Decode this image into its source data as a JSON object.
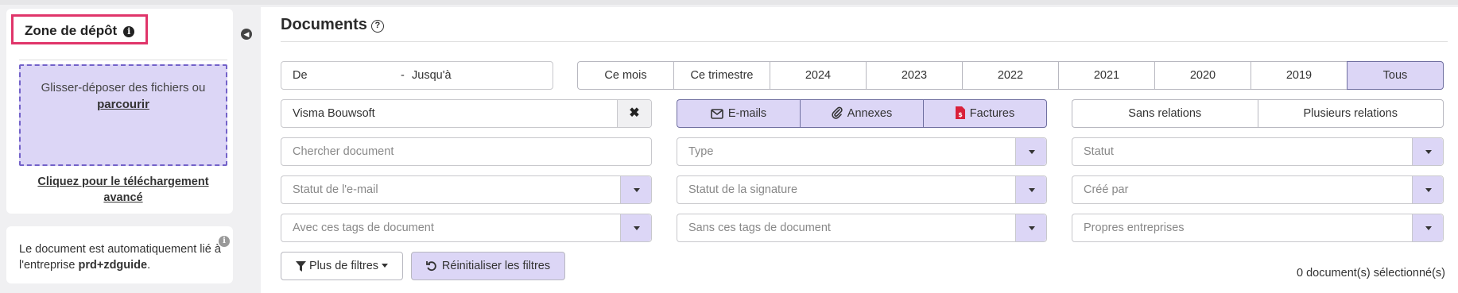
{
  "dropzone_card": {
    "title": "Zone de dépôt",
    "info_icon": "i",
    "dropzone_text": "Glisser-déposer des fichiers ou",
    "browse_link": "parcourir",
    "advanced_link": "Cliquez pour le téléchargement avancé"
  },
  "info_card": {
    "text_before": "Le document est automatiquement lié à l'entreprise ",
    "company": "prd+zdguide",
    "text_after": ".",
    "info_icon": "i"
  },
  "collapse_icon": "collapse-left-icon",
  "main": {
    "title": "Documents",
    "help_icon": "?",
    "date_range": {
      "from": "De",
      "separator": "-",
      "to": "Jusqu'à"
    },
    "period_buttons": [
      {
        "label": "Ce mois",
        "active": false
      },
      {
        "label": "Ce trimestre",
        "active": false
      },
      {
        "label": "2024",
        "active": false
      },
      {
        "label": "2023",
        "active": false
      },
      {
        "label": "2022",
        "active": false
      },
      {
        "label": "2021",
        "active": false
      },
      {
        "label": "2020",
        "active": false
      },
      {
        "label": "2019",
        "active": false
      },
      {
        "label": "Tous",
        "active": true
      }
    ],
    "company_filter": {
      "value": "Visma Bouwsoft",
      "clear": "✖"
    },
    "doc_type_toggles": [
      {
        "label": "E-mails",
        "icon": "envelope-icon"
      },
      {
        "label": "Annexes",
        "icon": "paperclip-icon"
      },
      {
        "label": "Factures",
        "icon": "invoice-icon"
      }
    ],
    "relation_buttons": [
      "Sans relations",
      "Plusieurs relations"
    ],
    "search_placeholder": "Chercher document",
    "dropdowns": {
      "type": "Type",
      "status": "Statut",
      "email_status": "Statut de l'e-mail",
      "signature_status": "Statut de la signature",
      "created_by": "Créé par",
      "with_tags": "Avec ces tags de document",
      "without_tags": "Sans ces tags de document",
      "own_companies": "Propres entreprises"
    },
    "more_filters": "Plus de filtres",
    "reset_filters": "Réinitialiser les filtres",
    "selected_count": "0 document(s) sélectionné(s)"
  },
  "colors": {
    "accent": "#dcd6f6",
    "highlight_border": "#e0356a",
    "dropzone_border": "#7362c9",
    "invoice_red": "#d9213b"
  }
}
